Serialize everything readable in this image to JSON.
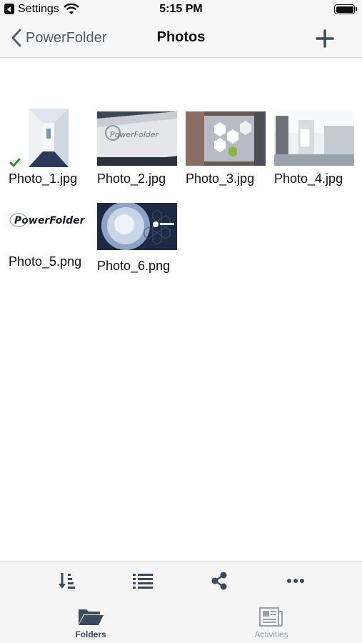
{
  "status_bar": {
    "back_app": "Settings",
    "time": "5:15 PM"
  },
  "nav": {
    "back_label": "PowerFolder",
    "title": "Photos"
  },
  "files": [
    {
      "name": "Photo_1.jpg",
      "synced": true
    },
    {
      "name": "Photo_2.jpg"
    },
    {
      "name": "Photo_3.jpg"
    },
    {
      "name": "Photo_4.jpg"
    },
    {
      "name": "Photo_5.png"
    },
    {
      "name": "Photo_6.png"
    }
  ],
  "thumb_text": {
    "brand": "PowerFolder"
  },
  "toolbar": [
    "sort-icon",
    "list-view-icon",
    "share-icon",
    "more-icon"
  ],
  "tabs": [
    {
      "label": "Folders",
      "active": true,
      "icon": "folder-icon"
    },
    {
      "label": "Activities",
      "active": false,
      "icon": "news-icon"
    }
  ],
  "colors": {
    "accent": "#3a4a5a",
    "check": "#2e8b2e"
  }
}
